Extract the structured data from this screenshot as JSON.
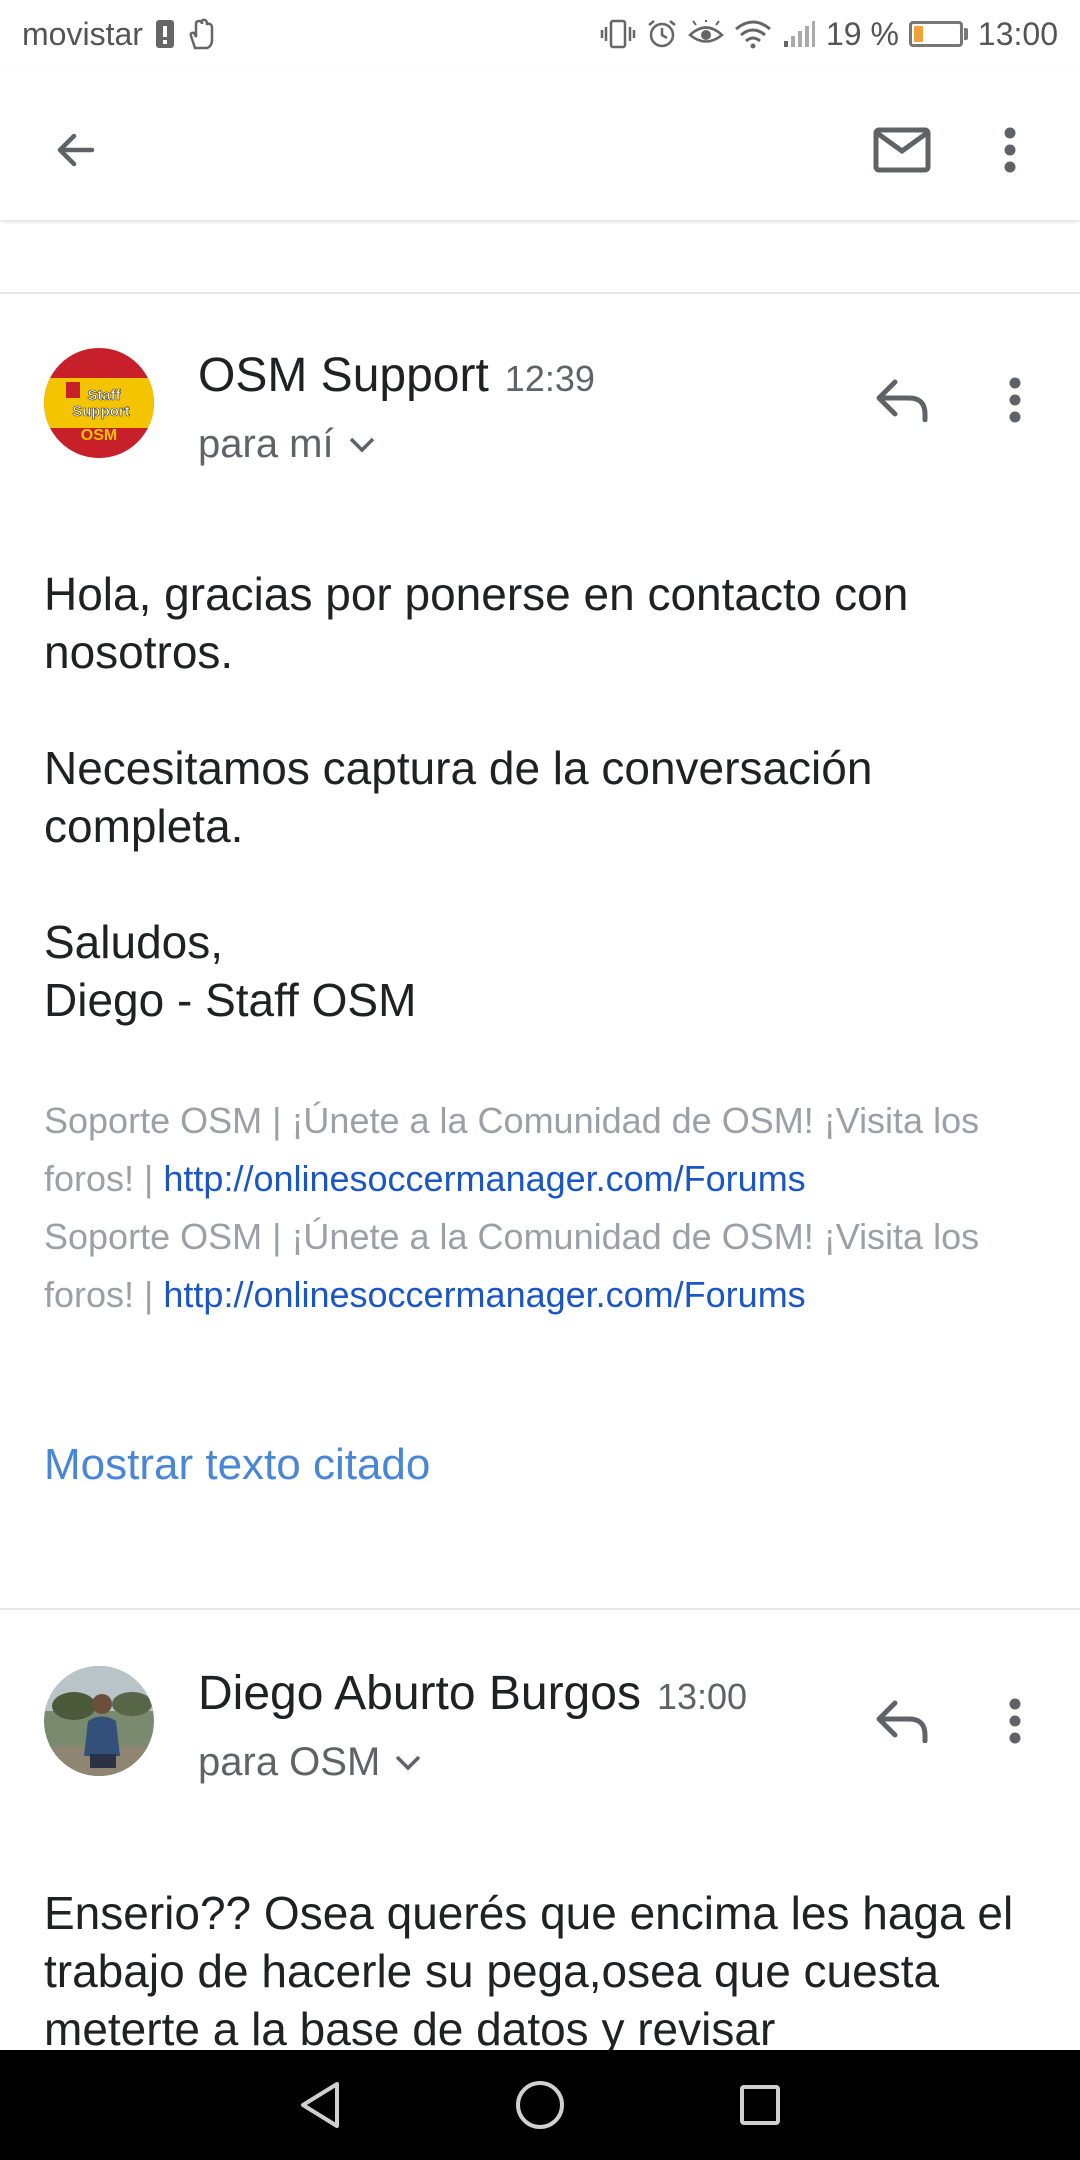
{
  "status_bar": {
    "carrier": "movistar",
    "battery_percent": "19 %",
    "battery_level": 0.19,
    "time": "13:00"
  },
  "app_bar": {
    "icons": [
      "back-arrow-icon",
      "mail-icon",
      "more-vert-icon"
    ]
  },
  "messages": [
    {
      "sender": "OSM Support",
      "time": "12:39",
      "recipient": "para mí",
      "avatar_text": [
        "Staff",
        "Support",
        "OSM"
      ],
      "body": [
        "Hola, gracias por ponerse en contacto con nosotros.",
        "Necesitamos captura de la conversación completa.",
        "Saludos,",
        "Diego - Staff OSM"
      ],
      "signature": [
        {
          "text": "Soporte OSM | ¡Únete a la Comunidad de OSM! ¡Visita los foros! | ",
          "link": "http://onlinesoccermanager.com/Forums"
        },
        {
          "text": "Soporte OSM | ¡Únete a la Comunidad de OSM! ¡Visita los foros! | ",
          "link": "http://onlinesoccermanager.com/Forums"
        }
      ],
      "show_quoted": "Mostrar texto citado"
    },
    {
      "sender": "Diego Aburto Burgos",
      "time": "13:00",
      "recipient": "para OSM",
      "body": [
        "Enserio?? Osea querés que encima les haga el trabajo de hacerle su pega,osea que cuesta meterte a la base de datos y revisar"
      ]
    }
  ],
  "colors": {
    "link": "#1a56c8",
    "show_quoted": "#4a86d8",
    "battery_fill": "#f0a13a"
  }
}
